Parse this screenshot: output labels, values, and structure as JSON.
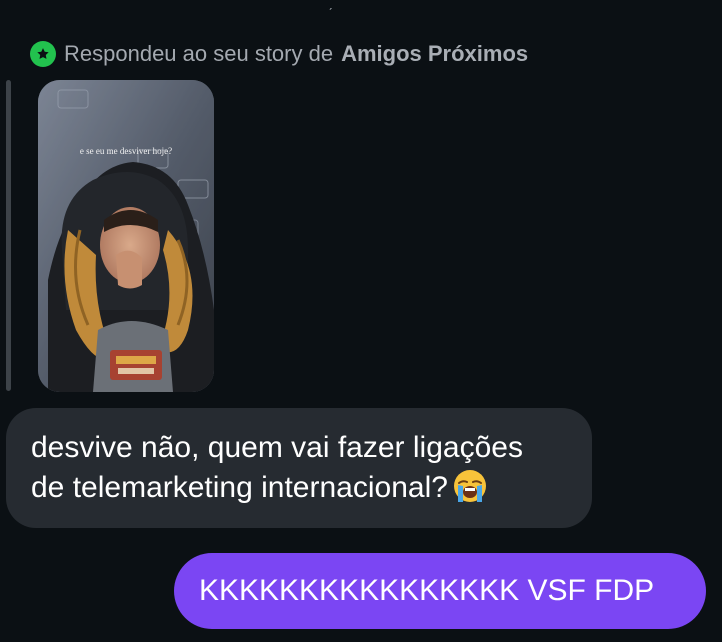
{
  "top_fragment": "ˏ",
  "reply_header": {
    "prefix": "Respondeu ao seu story de",
    "audience": "Amigos Próximos",
    "icon": "star-icon",
    "badge_color": "#22c24e"
  },
  "story": {
    "caption": "e se eu me desviver hoje?",
    "shirt_text": "Street Fighter"
  },
  "messages": [
    {
      "direction": "incoming",
      "lines": [
        "desvive não, quem vai fazer ligações",
        "de telemarketing internacional?"
      ],
      "emoji": "loudly-crying-face",
      "bubble_color": "#262b31"
    },
    {
      "direction": "outgoing",
      "text": "KKKKKKKKKKKKKKKK VSF FDP",
      "bubble_color": "#7b46f3"
    }
  ]
}
